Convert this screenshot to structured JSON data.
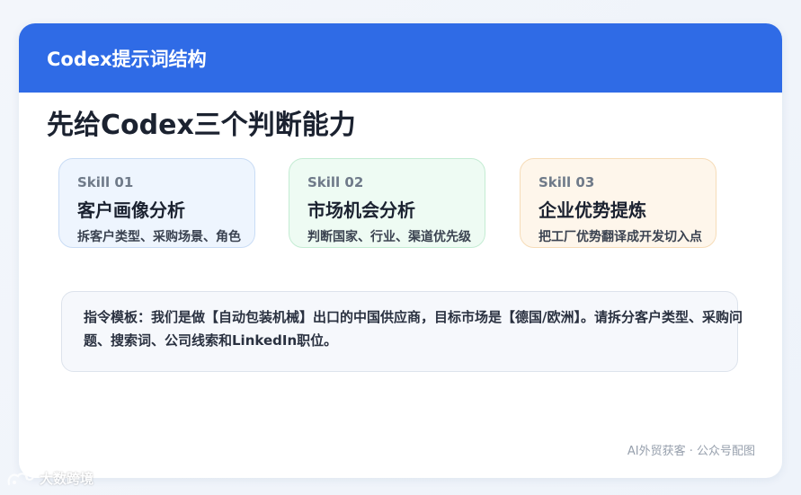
{
  "header": {
    "title": "Codex提示词结构"
  },
  "main": {
    "title": "先给Codex三个判断能力"
  },
  "skills": [
    {
      "num": "Skill 01",
      "name": "客户画像分析",
      "desc": "拆客户类型、采购场景、角色"
    },
    {
      "num": "Skill 02",
      "name": "市场机会分析",
      "desc": "判断国家、行业、渠道优先级"
    },
    {
      "num": "Skill 03",
      "name": "企业优势提炼",
      "desc": "把工厂优势翻译成开发切入点"
    }
  ],
  "prompt": {
    "text": "指令模板：我们是做【自动包装机械】出口的中国供应商，目标市场是【德国/欧洲】。请拆分客户类型、采购问题、搜索词、公司线索和LinkedIn职位。"
  },
  "footer": {
    "note": "AI外贸获客 · 公众号配图"
  },
  "watermark": {
    "logo": "dashu-logo-icon",
    "text": "大数跨境"
  },
  "colors": {
    "header_bg": "#2f6be6",
    "skill1_bg": "#eef5fe",
    "skill2_bg": "#eefbf3",
    "skill3_bg": "#fef6eb"
  }
}
